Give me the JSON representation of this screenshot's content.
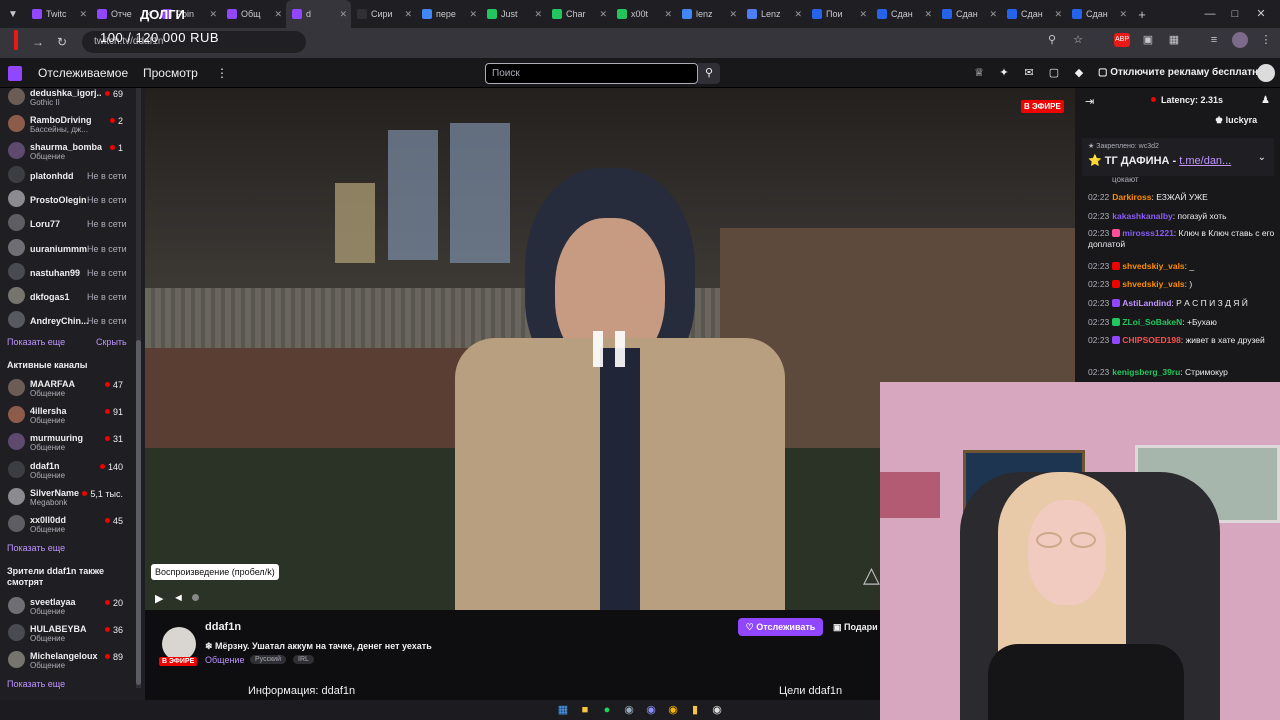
{
  "browser": {
    "tabs": [
      {
        "label": "Twitc",
        "fav_color": "#9146ff",
        "active": false
      },
      {
        "label": "Отче",
        "fav_color": "#9146ff",
        "active": false
      },
      {
        "label": "Poin",
        "fav_color": "#9146ff",
        "active": false
      },
      {
        "label": "Общ",
        "fav_color": "#9146ff",
        "active": false
      },
      {
        "label": "d",
        "fav_color": "#9146ff",
        "active": true
      },
      {
        "label": "Сири",
        "fav_color": "#2f2f35",
        "active": false
      },
      {
        "label": "пере",
        "fav_color": "#4285f4",
        "active": false
      },
      {
        "label": "Just",
        "fav_color": "#22c55e",
        "active": false
      },
      {
        "label": "Char",
        "fav_color": "#22c55e",
        "active": false
      },
      {
        "label": "x00t",
        "fav_color": "#22c55e",
        "active": false
      },
      {
        "label": "lenz",
        "fav_color": "#4285f4",
        "active": false
      },
      {
        "label": "Lenz",
        "fav_color": "#4f7cf7",
        "active": false
      },
      {
        "label": "Пои",
        "fav_color": "#2563eb",
        "active": false
      },
      {
        "label": "Сдан",
        "fav_color": "#2563eb",
        "active": false
      },
      {
        "label": "Сдан",
        "fav_color": "#2563eb",
        "active": false
      },
      {
        "label": "Сдан",
        "fav_color": "#2563eb",
        "active": false
      },
      {
        "label": "Сдан",
        "fav_color": "#2563eb",
        "active": false
      }
    ],
    "url": "twitch.tv/ddaf1n",
    "overlay_goal": "100 / 120 000 RUB",
    "overlay_logo": "ДОЛГИ"
  },
  "nav": {
    "following": "Отслеживаемое",
    "browse": "Просмотр",
    "search_placeholder": "Поиск",
    "adfree": "Отключите рекламу бесплатно"
  },
  "sidebar": {
    "top_channels": [
      {
        "name": "dedushka_igorj...",
        "category": "Gothic II",
        "viewers": "69"
      },
      {
        "name": "RamboDriving",
        "category": "Бассейны, дж...",
        "viewers": "2"
      },
      {
        "name": "shaurma_bomba",
        "category": "Общение",
        "viewers": "1"
      }
    ],
    "offline_channels": [
      {
        "name": "platonhdd",
        "status": "Не в сети"
      },
      {
        "name": "ProstoOlegin",
        "status": "Не в сети"
      },
      {
        "name": "Loru77",
        "status": "Не в сети"
      },
      {
        "name": "uuraniummm",
        "status": "Не в сети"
      },
      {
        "name": "nastuhan99",
        "status": "Не в сети"
      },
      {
        "name": "dkfogas1",
        "status": "Не в сети"
      },
      {
        "name": "AndreyChin...",
        "status": "Не в сети"
      }
    ],
    "show_more": "Показать еще",
    "hide": "Скрыть",
    "active_heading": "Активные каналы",
    "active_channels": [
      {
        "name": "MAARFAA",
        "category": "Общение",
        "viewers": "47"
      },
      {
        "name": "4illersha",
        "category": "Общение",
        "viewers": "91"
      },
      {
        "name": "murmuuring",
        "category": "Общение",
        "viewers": "31"
      },
      {
        "name": "ddaf1n",
        "category": "Общение",
        "viewers": "140"
      },
      {
        "name": "SilverName",
        "category": "Megabonk",
        "viewers": "5,1 тыс."
      },
      {
        "name": "xx0ll0dd",
        "category": "Общение",
        "viewers": "45"
      }
    ],
    "show_more_2": "Показать еще",
    "viewers_heading": "Зрители ddaf1n также смотрят",
    "also_watch": [
      {
        "name": "sveetlayaa",
        "category": "Общение",
        "viewers": "20"
      },
      {
        "name": "HULABEYBA",
        "category": "Общение",
        "viewers": "36"
      },
      {
        "name": "Michelangeloux",
        "category": "Общение",
        "viewers": "89"
      }
    ],
    "show_more_3": "Показать еще"
  },
  "player": {
    "live_badge": "В ЭФИРЕ",
    "tooltip": "Воспроизведение (пробел/k)"
  },
  "stream": {
    "streamer": "ddaf1n",
    "live": "В ЭФИРЕ",
    "title": "Мёрзну. Ушатал аккум на тачке, денег нет уехать",
    "category": "Общение",
    "tags": [
      "Русский",
      "IRL"
    ],
    "follow": "Отслеживать",
    "gift": "Подари",
    "about": "Информация: ddaf1n",
    "goals": "Цели ddaf1n"
  },
  "chat": {
    "latency": "Latency: 2.31s",
    "top_user": "luckyra",
    "pinned_label": "Закреплено:",
    "pinned_by": "wc3d2",
    "pinned_text": "ТГ ДАФИНА - ",
    "pinned_link": "t.me/dan...",
    "cut_text": "цокают",
    "messages": [
      {
        "time": "02:22",
        "user": "Darkiross",
        "color": "#ff8c00",
        "text": "ЕЗЖАЙ УЖЕ",
        "badge": ""
      },
      {
        "time": "02:23",
        "user": "kakashkanalby",
        "color": "#8a5cf6",
        "text": "погазуй хоть",
        "badge": ""
      },
      {
        "time": "02:23",
        "user": "mirosss1221",
        "color": "#8a5cf6",
        "text": "Ключ в Ключ ставь с его доплатой",
        "badge": "#ff4f9a"
      },
      {
        "time": "02:23",
        "user": "shvedskiy_vals",
        "color": "#ff8c00",
        "text": "_",
        "badge": "#eb0400"
      },
      {
        "time": "02:23",
        "user": "shvedskiy_vals",
        "color": "#ff8c00",
        "text": ")",
        "badge": "#eb0400"
      },
      {
        "time": "02:23",
        "user": "AstiLandind",
        "color": "#bf94ff",
        "text": "Р А С П И З Д Я Й",
        "badge": "#9146ff"
      },
      {
        "time": "02:23",
        "user": "ZLoi_SoBakeN",
        "color": "#22c55e",
        "text": "+Бухаю",
        "badge": "#22c55e"
      },
      {
        "time": "02:23",
        "user": "CHIPSOED198",
        "color": "#ff4f4f",
        "text": "живет в хате друзей",
        "badge": "#9146ff"
      },
      {
        "time": "02:23",
        "user": "kenigsberg_39ru",
        "color": "#22c55e",
        "text": "Стримокур",
        "badge": ""
      }
    ]
  },
  "colors": {
    "accent": "#9146ff",
    "live": "#eb0400",
    "link": "#bf94ff"
  }
}
